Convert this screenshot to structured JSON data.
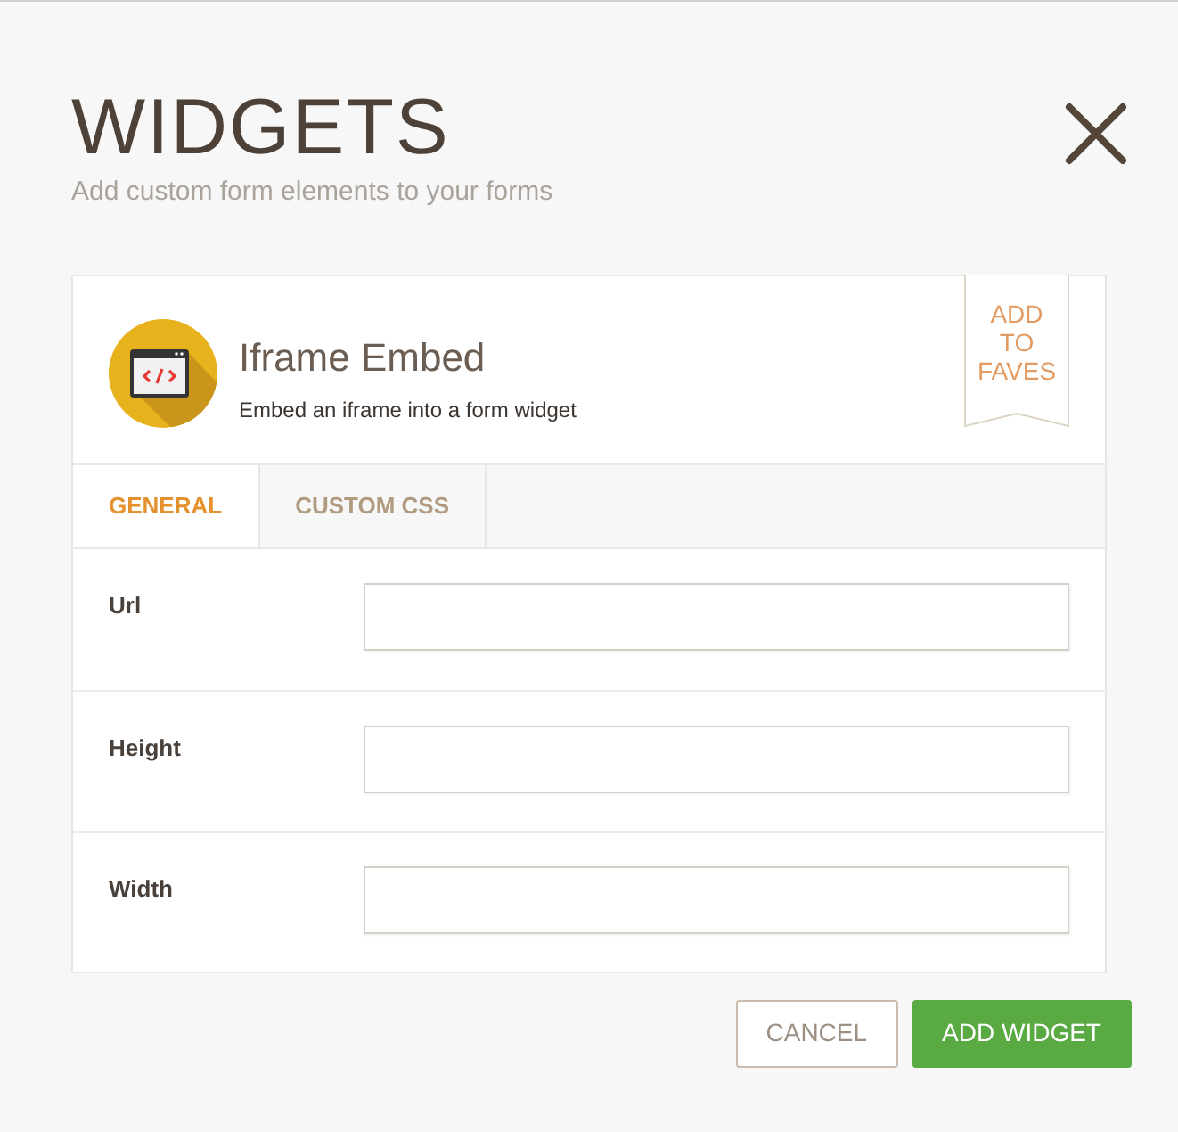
{
  "header": {
    "title": "WIDGETS",
    "subtitle": "Add custom form elements to your forms"
  },
  "widget": {
    "name": "Iframe Embed",
    "description": "Embed an iframe into a form widget",
    "fave_label": [
      "ADD",
      "TO",
      "FAVES"
    ]
  },
  "tabs": [
    {
      "label": "GENERAL",
      "selected": true
    },
    {
      "label": "CUSTOM CSS",
      "selected": false
    }
  ],
  "fields": [
    {
      "label": "Url"
    },
    {
      "label": "Height"
    },
    {
      "label": "Width"
    }
  ],
  "buttons": [
    {
      "label": "CANCEL",
      "kind": "secondary"
    },
    {
      "label": "ADD WIDGET",
      "kind": "primary"
    }
  ]
}
